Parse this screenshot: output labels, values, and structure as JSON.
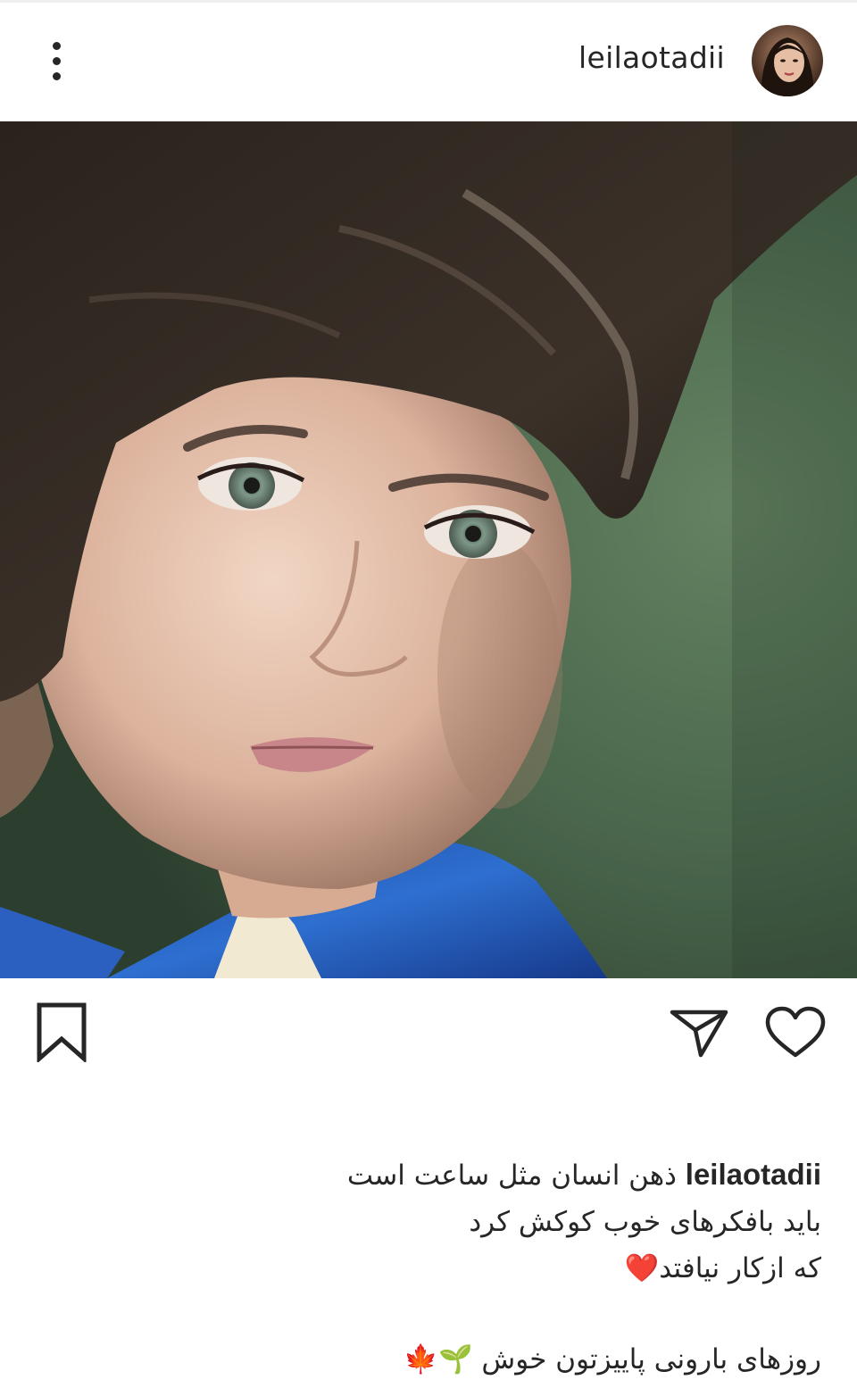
{
  "post": {
    "username": "leilaotadii",
    "caption": {
      "username": "leilaotadii",
      "line1_text": "ذهن انسان مثل ساعت است",
      "line2": "باید بافکرهای خوب کوکش کرد",
      "line3": "که ازکار نیافتد‌❤️",
      "line4": "روزهای بارونی پاییزتون خوش 🌱🍁"
    }
  },
  "icons": {
    "menu": "more-vertical-icon",
    "bookmark": "bookmark-icon",
    "share": "send-icon",
    "like": "heart-icon"
  },
  "colors": {
    "text": "#262626",
    "divider": "#efefef",
    "heart_emoji": "#e0245e"
  }
}
